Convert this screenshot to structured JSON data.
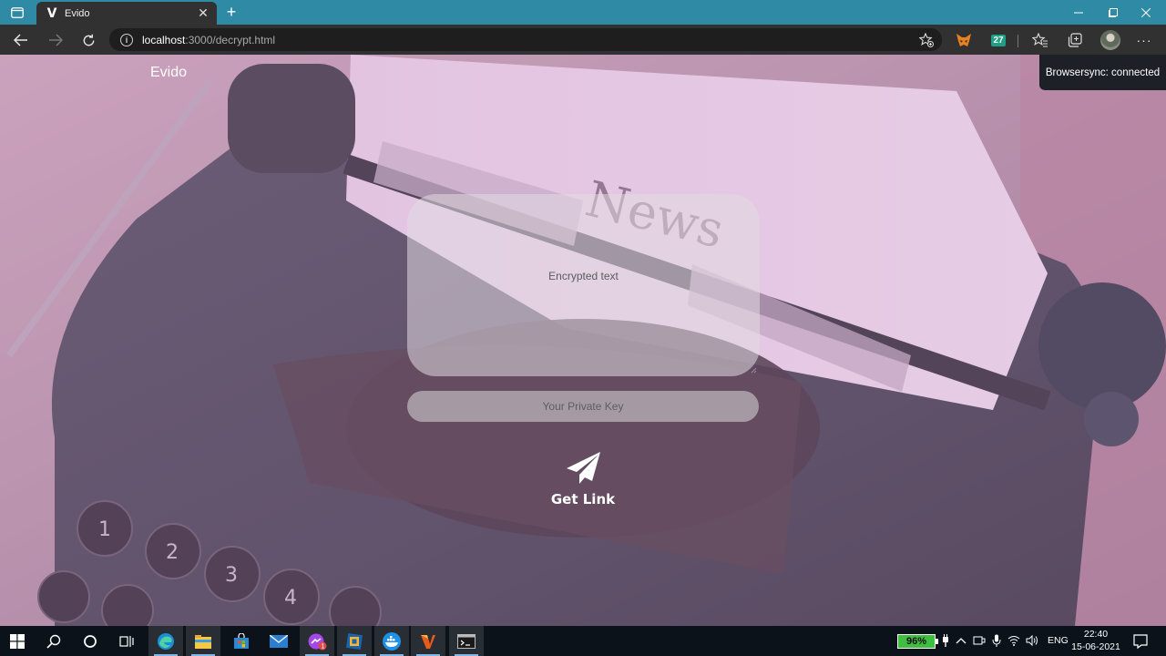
{
  "browser": {
    "tab_title": "Evido",
    "tab_favicon": "V",
    "url_host": "localhost",
    "url_path": ":3000/decrypt.html",
    "ext_calendar_label": "27"
  },
  "page": {
    "brand": "Evido",
    "browsersync": "Browsersync: connected",
    "encrypted_placeholder": "Encrypted text",
    "private_key_placeholder": "Your Private Key",
    "get_link_label": "Get Link",
    "background_description_icon": "typewriter-news-photo"
  },
  "taskbar": {
    "battery": "96%",
    "language": "ENG",
    "time": "22:40",
    "date": "15-06-2021",
    "messenger_badge": "1"
  },
  "colors": {
    "tabbar": "#2f8aa6",
    "chrome": "#313131",
    "taskbar": "#0b1219",
    "battery": "#3fbf3f"
  }
}
